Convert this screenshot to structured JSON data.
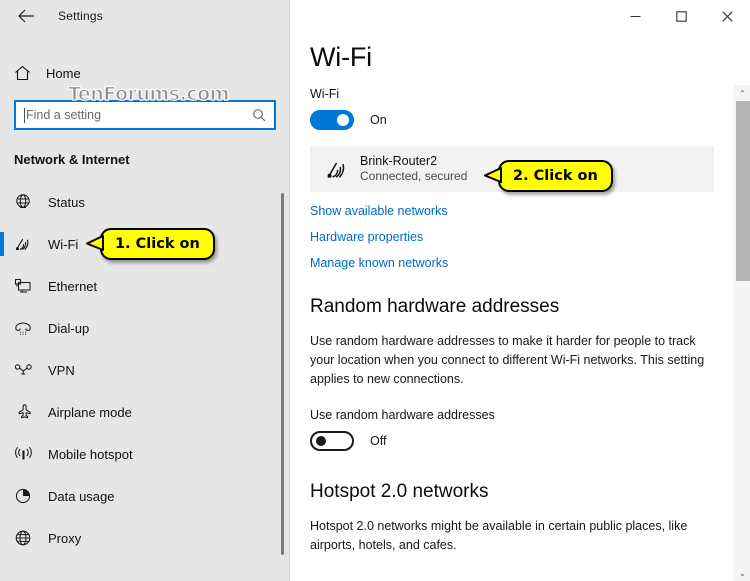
{
  "window": {
    "title": "Settings",
    "back_icon": "back-arrow-icon",
    "minimize_label": "—",
    "maximize_label": "□",
    "close_label": "✕"
  },
  "watermark": {
    "text": "TenForums.com"
  },
  "sidebar": {
    "home": {
      "label": "Home",
      "icon": "home-icon"
    },
    "search": {
      "placeholder": "Find a setting",
      "value": "",
      "icon": "search-icon"
    },
    "category": "Network & Internet",
    "items": [
      {
        "label": "Status",
        "icon": "globe-status-icon",
        "selected": false
      },
      {
        "label": "Wi-Fi",
        "icon": "wifi-icon",
        "selected": true
      },
      {
        "label": "Ethernet",
        "icon": "ethernet-icon",
        "selected": false
      },
      {
        "label": "Dial-up",
        "icon": "dialup-phone-icon",
        "selected": false
      },
      {
        "label": "VPN",
        "icon": "vpn-key-icon",
        "selected": false
      },
      {
        "label": "Airplane mode",
        "icon": "airplane-icon",
        "selected": false
      },
      {
        "label": "Mobile hotspot",
        "icon": "mobile-hotspot-icon",
        "selected": false
      },
      {
        "label": "Data usage",
        "icon": "pie-chart-icon",
        "selected": false
      },
      {
        "label": "Proxy",
        "icon": "globe-proxy-icon",
        "selected": false
      }
    ]
  },
  "main": {
    "page_title": "Wi-Fi",
    "wifi": {
      "label": "Wi-Fi",
      "toggle_state": "On",
      "toggle_on": true
    },
    "network": {
      "name": "Brink-Router2",
      "status": "Connected, secured",
      "icon": "wifi-connected-icon"
    },
    "links": [
      "Show available networks",
      "Hardware properties",
      "Manage known networks"
    ],
    "random_hw": {
      "heading": "Random hardware addresses",
      "description": "Use random hardware addresses to make it harder for people to track your location when you connect to different Wi-Fi networks. This setting applies to new connections.",
      "toggle_label": "Use random hardware addresses",
      "toggle_state": "Off",
      "toggle_on": false
    },
    "hotspot": {
      "heading": "Hotspot 2.0 networks",
      "description": "Hotspot 2.0 networks might be available in certain public places, like airports, hotels, and cafes."
    }
  },
  "callouts": [
    {
      "id": 1,
      "text": "1. Click on"
    },
    {
      "id": 2,
      "text": "2. Click on"
    }
  ],
  "colors": {
    "accent": "#0078d7",
    "link": "#0068c8",
    "sidebar_bg": "#e6e6e6",
    "callout_bg": "#ffff00",
    "network_row_bg": "#f2f2f2"
  },
  "scrollbar": {
    "up_arrow": "⌃",
    "down_arrow": "⌄"
  }
}
